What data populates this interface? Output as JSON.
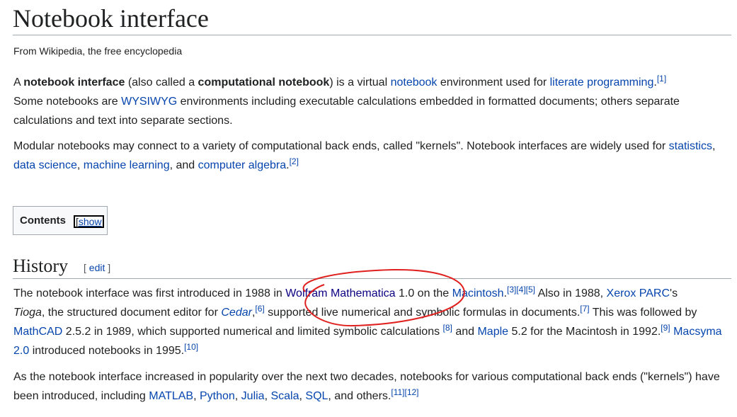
{
  "article": {
    "title": "Notebook interface",
    "tagline": "From Wikipedia, the free encyclopedia"
  },
  "intro": {
    "p1": {
      "t1": "A ",
      "b1": "notebook interface",
      "t2": " (also called a ",
      "b2": "computational notebook",
      "t3": ") is a virtual ",
      "l1": "notebook",
      "t4": " environment used for ",
      "l2": "literate programming",
      "t5": ".",
      "c1": "[1]",
      "t6": " Some notebooks are ",
      "l3": "WYSIWYG",
      "t7": " environments including executable calculations embedded in formatted documents; others separate calculations and text into separate sections."
    },
    "p2": {
      "t1": "Modular notebooks may connect to a variety of computational back ends, called \"kernels\". Notebook interfaces are widely used for ",
      "l1": "statistics",
      "t2": ", ",
      "l2": "data science",
      "t3": ", ",
      "l3": "machine learning",
      "t4": ", and ",
      "l4": "computer algebra",
      "t5": ".",
      "c1": "[2]"
    }
  },
  "toc": {
    "title": "Contents",
    "toggle": "show"
  },
  "history": {
    "heading": "History",
    "edit_open": "[ ",
    "edit_label": "edit",
    "edit_close": " ]",
    "p1": {
      "t1": "The notebook interface was first introduced in 1988 in ",
      "l1": "Wolfram Mathematica",
      "t2": " 1.0 on the ",
      "l2": "Macintosh",
      "t3": ".",
      "c1": "[3]",
      "c2": "[4]",
      "c3": "[5]",
      "t4": " Also in 1988, ",
      "l3": "Xerox PARC",
      "t5": "'s ",
      "i1": "Tioga",
      "t6": ", the structured document editor for ",
      "l4": "Cedar",
      "t7": ",",
      "c4": "[6]",
      "t8": " supported live numerical and symbolic formulas in documents.",
      "c5": "[7]",
      "t9": " This was followed by ",
      "l5": "MathCAD",
      "t10": " 2.5.2 in 1989, which supported numerical and limited symbolic calculations ",
      "c6": "[8]",
      "t11": " and ",
      "l6": "Maple",
      "t12": " 5.2 for the Macintosh in 1992.",
      "c7": "[9]",
      "t13": " ",
      "l7": "Macsyma 2.0",
      "t14": " introduced notebooks in 1995.",
      "c8": "[10]"
    },
    "p2": {
      "t1": "As the notebook interface increased in popularity over the next two decades, notebooks for various computational back ends (\"kernels\") have been introduced, including ",
      "l1": "MATLAB",
      "t2": ", ",
      "l2": "Python",
      "t3": ", ",
      "l3": "Julia",
      "t4": ", ",
      "l4": "Scala",
      "t5": ", ",
      "l5": "SQL",
      "t6": ", and others.",
      "c1": "[11]",
      "c2": "[12]"
    }
  },
  "colors": {
    "link": "#0645ad",
    "visited_link": "#0b0080",
    "annotation": "#e0201e"
  }
}
